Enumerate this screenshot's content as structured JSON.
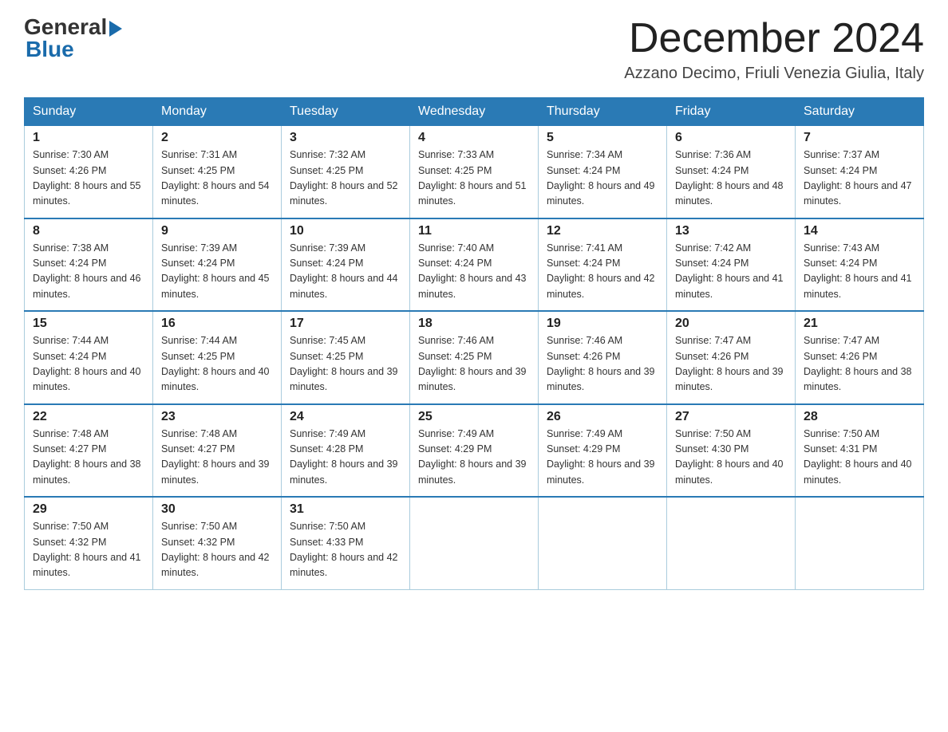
{
  "header": {
    "logo_general": "General",
    "logo_blue": "Blue",
    "month_title": "December 2024",
    "location": "Azzano Decimo, Friuli Venezia Giulia, Italy"
  },
  "days_of_week": [
    "Sunday",
    "Monday",
    "Tuesday",
    "Wednesday",
    "Thursday",
    "Friday",
    "Saturday"
  ],
  "weeks": [
    [
      {
        "day": "1",
        "sunrise": "7:30 AM",
        "sunset": "4:26 PM",
        "daylight": "8 hours and 55 minutes."
      },
      {
        "day": "2",
        "sunrise": "7:31 AM",
        "sunset": "4:25 PM",
        "daylight": "8 hours and 54 minutes."
      },
      {
        "day": "3",
        "sunrise": "7:32 AM",
        "sunset": "4:25 PM",
        "daylight": "8 hours and 52 minutes."
      },
      {
        "day": "4",
        "sunrise": "7:33 AM",
        "sunset": "4:25 PM",
        "daylight": "8 hours and 51 minutes."
      },
      {
        "day": "5",
        "sunrise": "7:34 AM",
        "sunset": "4:24 PM",
        "daylight": "8 hours and 49 minutes."
      },
      {
        "day": "6",
        "sunrise": "7:36 AM",
        "sunset": "4:24 PM",
        "daylight": "8 hours and 48 minutes."
      },
      {
        "day": "7",
        "sunrise": "7:37 AM",
        "sunset": "4:24 PM",
        "daylight": "8 hours and 47 minutes."
      }
    ],
    [
      {
        "day": "8",
        "sunrise": "7:38 AM",
        "sunset": "4:24 PM",
        "daylight": "8 hours and 46 minutes."
      },
      {
        "day": "9",
        "sunrise": "7:39 AM",
        "sunset": "4:24 PM",
        "daylight": "8 hours and 45 minutes."
      },
      {
        "day": "10",
        "sunrise": "7:39 AM",
        "sunset": "4:24 PM",
        "daylight": "8 hours and 44 minutes."
      },
      {
        "day": "11",
        "sunrise": "7:40 AM",
        "sunset": "4:24 PM",
        "daylight": "8 hours and 43 minutes."
      },
      {
        "day": "12",
        "sunrise": "7:41 AM",
        "sunset": "4:24 PM",
        "daylight": "8 hours and 42 minutes."
      },
      {
        "day": "13",
        "sunrise": "7:42 AM",
        "sunset": "4:24 PM",
        "daylight": "8 hours and 41 minutes."
      },
      {
        "day": "14",
        "sunrise": "7:43 AM",
        "sunset": "4:24 PM",
        "daylight": "8 hours and 41 minutes."
      }
    ],
    [
      {
        "day": "15",
        "sunrise": "7:44 AM",
        "sunset": "4:24 PM",
        "daylight": "8 hours and 40 minutes."
      },
      {
        "day": "16",
        "sunrise": "7:44 AM",
        "sunset": "4:25 PM",
        "daylight": "8 hours and 40 minutes."
      },
      {
        "day": "17",
        "sunrise": "7:45 AM",
        "sunset": "4:25 PM",
        "daylight": "8 hours and 39 minutes."
      },
      {
        "day": "18",
        "sunrise": "7:46 AM",
        "sunset": "4:25 PM",
        "daylight": "8 hours and 39 minutes."
      },
      {
        "day": "19",
        "sunrise": "7:46 AM",
        "sunset": "4:26 PM",
        "daylight": "8 hours and 39 minutes."
      },
      {
        "day": "20",
        "sunrise": "7:47 AM",
        "sunset": "4:26 PM",
        "daylight": "8 hours and 39 minutes."
      },
      {
        "day": "21",
        "sunrise": "7:47 AM",
        "sunset": "4:26 PM",
        "daylight": "8 hours and 38 minutes."
      }
    ],
    [
      {
        "day": "22",
        "sunrise": "7:48 AM",
        "sunset": "4:27 PM",
        "daylight": "8 hours and 38 minutes."
      },
      {
        "day": "23",
        "sunrise": "7:48 AM",
        "sunset": "4:27 PM",
        "daylight": "8 hours and 39 minutes."
      },
      {
        "day": "24",
        "sunrise": "7:49 AM",
        "sunset": "4:28 PM",
        "daylight": "8 hours and 39 minutes."
      },
      {
        "day": "25",
        "sunrise": "7:49 AM",
        "sunset": "4:29 PM",
        "daylight": "8 hours and 39 minutes."
      },
      {
        "day": "26",
        "sunrise": "7:49 AM",
        "sunset": "4:29 PM",
        "daylight": "8 hours and 39 minutes."
      },
      {
        "day": "27",
        "sunrise": "7:50 AM",
        "sunset": "4:30 PM",
        "daylight": "8 hours and 40 minutes."
      },
      {
        "day": "28",
        "sunrise": "7:50 AM",
        "sunset": "4:31 PM",
        "daylight": "8 hours and 40 minutes."
      }
    ],
    [
      {
        "day": "29",
        "sunrise": "7:50 AM",
        "sunset": "4:32 PM",
        "daylight": "8 hours and 41 minutes."
      },
      {
        "day": "30",
        "sunrise": "7:50 AM",
        "sunset": "4:32 PM",
        "daylight": "8 hours and 42 minutes."
      },
      {
        "day": "31",
        "sunrise": "7:50 AM",
        "sunset": "4:33 PM",
        "daylight": "8 hours and 42 minutes."
      },
      null,
      null,
      null,
      null
    ]
  ]
}
